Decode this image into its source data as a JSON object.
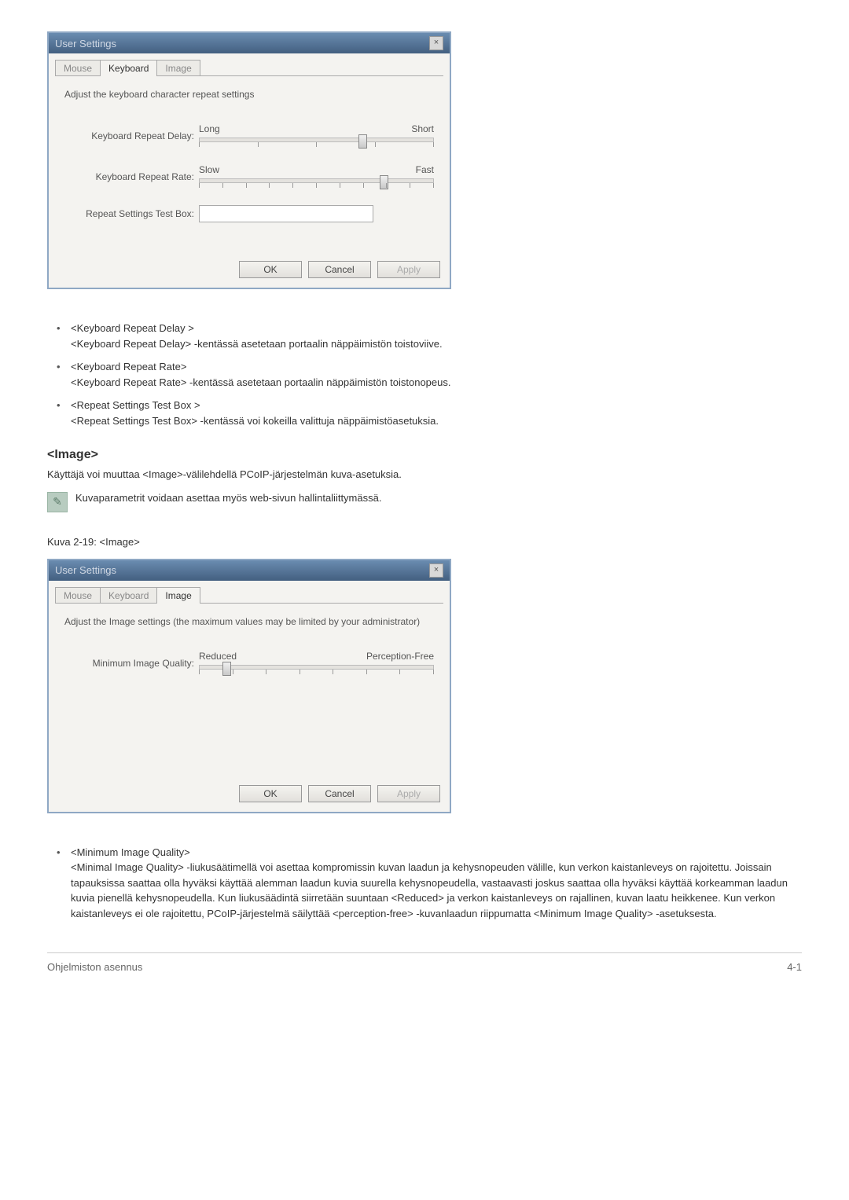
{
  "dialog1": {
    "title": "User Settings",
    "close": "×",
    "tabs": [
      "Mouse",
      "Keyboard",
      "Image"
    ],
    "active_tab": 1,
    "desc": "Adjust the keyboard character repeat settings",
    "delay_label": "Keyboard Repeat Delay:",
    "delay_left": "Long",
    "delay_right": "Short",
    "rate_label": "Keyboard Repeat Rate:",
    "rate_left": "Slow",
    "rate_right": "Fast",
    "test_label": "Repeat Settings Test Box:",
    "ok": "OK",
    "cancel": "Cancel",
    "apply": "Apply"
  },
  "list1": [
    {
      "term": "<Keyboard Repeat Delay >",
      "desc": "<Keyboard Repeat Delay> -kentässä asetetaan portaalin näppäimistön toistoviive."
    },
    {
      "term": "<Keyboard Repeat Rate>",
      "desc": "<Keyboard Repeat Rate> -kentässä asetetaan portaalin näppäimistön toistonopeus."
    },
    {
      "term": "<Repeat Settings Test Box >",
      "desc": "<Repeat Settings Test Box> -kentässä voi kokeilla valittuja näppäimistöasetuksia."
    }
  ],
  "section_heading": "<Image>",
  "section_text": "Käyttäjä voi muuttaa <Image>-välilehdellä PCoIP-järjestelmän kuva-asetuksia.",
  "note_text": "Kuvaparametrit voidaan asettaa myös web-sivun hallintaliittymässä.",
  "fig_caption": "Kuva 2-19: <Image>",
  "dialog2": {
    "title": "User Settings",
    "close": "×",
    "tabs": [
      "Mouse",
      "Keyboard",
      "Image"
    ],
    "active_tab": 2,
    "desc": "Adjust the Image settings (the maximum values may be limited by your administrator)",
    "quality_label": "Minimum Image Quality:",
    "quality_left": "Reduced",
    "quality_right": "Perception-Free",
    "ok": "OK",
    "cancel": "Cancel",
    "apply": "Apply"
  },
  "list2": [
    {
      "term": "<Minimum Image Quality>",
      "desc": "<Minimal Image Quality> -liukusäätimellä voi asettaa kompromissin kuvan laadun ja kehysnopeuden välille, kun verkon kaistanleveys on rajoitettu. Joissain tapauksissa saattaa olla hyväksi käyttää alemman laadun kuvia suurella kehysnopeudella, vastaavasti joskus saattaa olla hyväksi käyttää korkeamman laadun kuvia pienellä kehysnopeudella. Kun liukusäädintä siirretään suuntaan <Reduced> ja verkon kaistanleveys on rajallinen, kuvan laatu heikkenee. Kun verkon kaistanleveys ei ole rajoitettu, PCoIP-järjestelmä säilyttää <perception-free> -kuvanlaadun riippumatta <Minimum Image Quality> -asetuksesta."
    }
  ],
  "footer_left": "Ohjelmiston asennus",
  "footer_right": "4-1"
}
